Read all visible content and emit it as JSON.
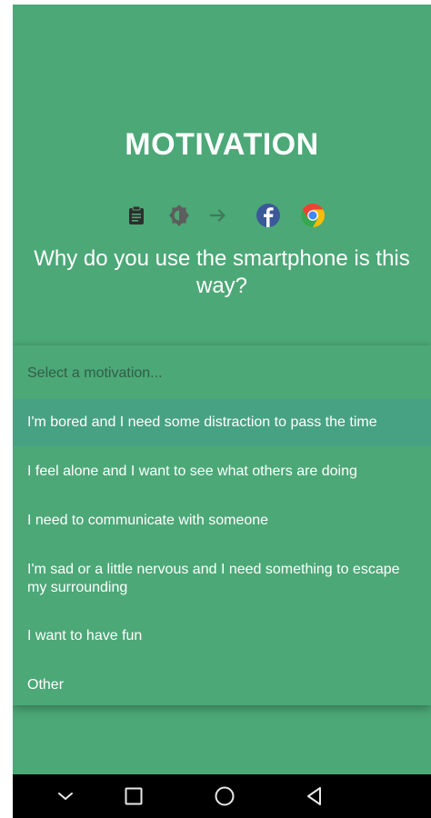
{
  "page": {
    "title": "MOTIVATION",
    "question": "Why do you use the smartphone is this way?"
  },
  "icons": [
    {
      "name": "clipboard-icon",
      "color": "#2e2e2e"
    },
    {
      "name": "brightness-icon",
      "color": "#5d5d5d"
    },
    {
      "name": "arrow-right-icon",
      "color": "#3f7a58"
    },
    {
      "name": "facebook-icon",
      "color": "#3b5998"
    },
    {
      "name": "chrome-icon",
      "color": "#ea4335"
    }
  ],
  "dropdown": {
    "placeholder": "Select a motivation...",
    "options": [
      {
        "label": "I'm bored and I need some distraction to pass the time",
        "selected": true
      },
      {
        "label": "I feel alone and I want to see what others are doing",
        "selected": false
      },
      {
        "label": "I need to communicate with someone",
        "selected": false
      },
      {
        "label": "I'm sad or a little nervous and I need something to escape my surrounding",
        "selected": false
      },
      {
        "label": "I want to have fun",
        "selected": false
      },
      {
        "label": "Other",
        "selected": false
      }
    ]
  },
  "colors": {
    "background": "#4ca877",
    "selected_option": "#46a283",
    "navbar": "#000000"
  },
  "navbar": [
    "chevron-down-icon",
    "square-icon",
    "circle-icon",
    "triangle-back-icon"
  ]
}
